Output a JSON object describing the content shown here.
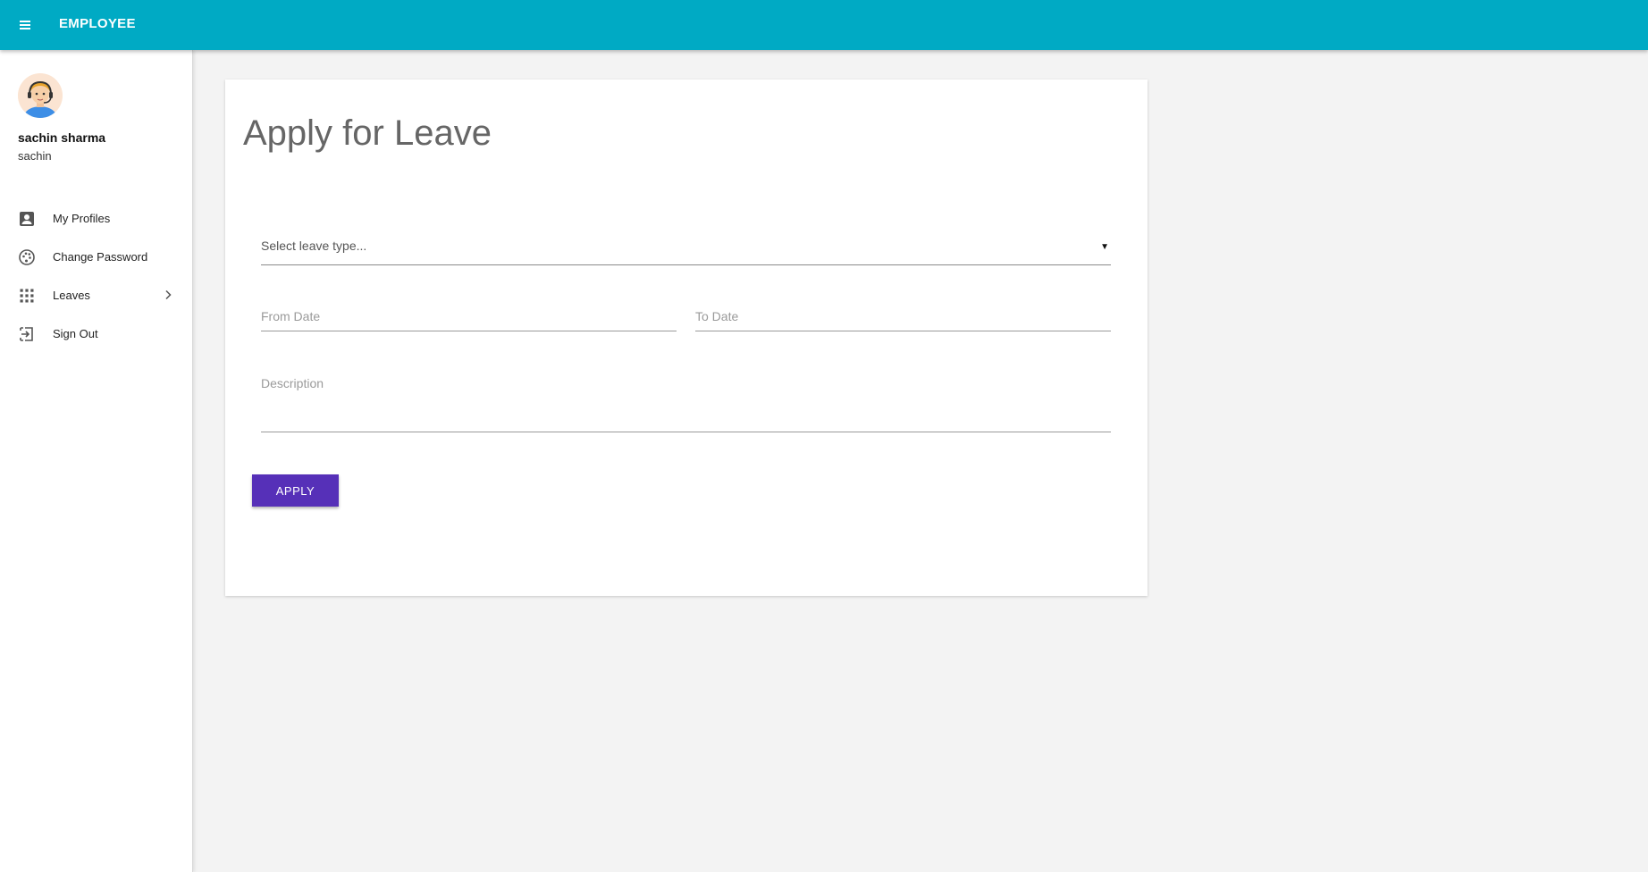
{
  "header": {
    "menu_icon": "hamburger-menu-icon",
    "title": "EMPLOYEE",
    "color": "#00aac4"
  },
  "user": {
    "name": "sachin sharma",
    "username": "sachin",
    "avatar": "support-agent-avatar"
  },
  "sidebar": {
    "items": [
      {
        "label": "My Profiles",
        "icon": "account-box-icon"
      },
      {
        "label": "Change Password",
        "icon": "palette-icon"
      },
      {
        "label": "Leaves",
        "icon": "apps-grid-icon",
        "has_submenu": true
      },
      {
        "label": "Sign Out",
        "icon": "sign-out-icon"
      }
    ]
  },
  "form": {
    "title": "Apply for Leave",
    "leave_type": {
      "placeholder": "Select leave type...",
      "value": ""
    },
    "from_date": {
      "placeholder": "From Date",
      "value": ""
    },
    "to_date": {
      "placeholder": "To Date",
      "value": ""
    },
    "description": {
      "placeholder": "Description",
      "value": ""
    },
    "apply_label": "APPLY",
    "apply_color": "#5630b8"
  }
}
